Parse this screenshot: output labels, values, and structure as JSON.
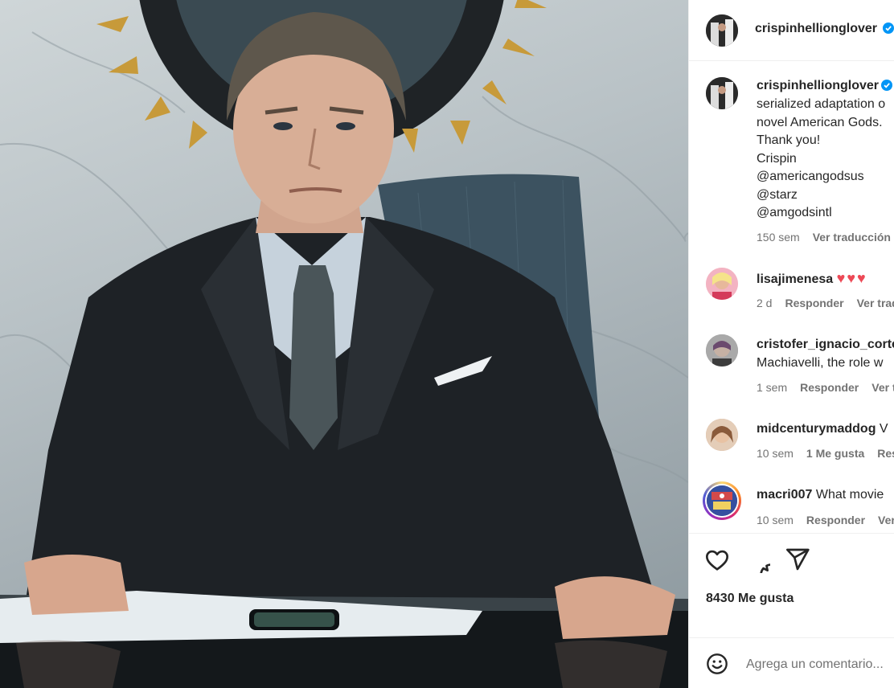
{
  "post": {
    "image_alt": "Man in a dark three-piece suit seated at a glass desk in front of a marble wall with a spiked sunburst mirror",
    "author": "crispinhellionglover",
    "verified": true
  },
  "caption": {
    "username": "crispinhellionglover",
    "lines": [
      "serialized adaptation o",
      "novel American Gods.",
      "Thank you!",
      "Crispin"
    ],
    "mentions": [
      "@americangodsus",
      "@starz",
      "@amgodsintl"
    ],
    "time": "150 sem",
    "translate": "Ver traducción"
  },
  "comments": [
    {
      "username": "lisajimenesa",
      "text": "♥♥♥",
      "time": "2 d",
      "reply": "Responder",
      "translate": "Ver trad"
    },
    {
      "username": "cristofer_ignacio_corte",
      "text": "Machiavelli, the role w",
      "time": "1 sem",
      "reply": "Responder",
      "translate": "Ver t"
    },
    {
      "username": "midcenturymaddog",
      "text": "V",
      "time": "10 sem",
      "likes": "1 Me gusta",
      "reply": "Res"
    },
    {
      "username": "macri007",
      "text": "What movie",
      "time": "10 sem",
      "reply": "Responder",
      "translate": "Ver"
    }
  ],
  "actions": {
    "like_icon": "heart-icon",
    "comment_icon": "comment-icon",
    "share_icon": "share-icon",
    "likes": "8430 Me gusta"
  },
  "add_comment": {
    "emoji_icon": "emoji-icon",
    "placeholder": "Agrega un comentario..."
  },
  "colors": {
    "link": "#00376b",
    "verified": "#0095f6",
    "heart": "#ed4956",
    "muted": "#737373"
  }
}
